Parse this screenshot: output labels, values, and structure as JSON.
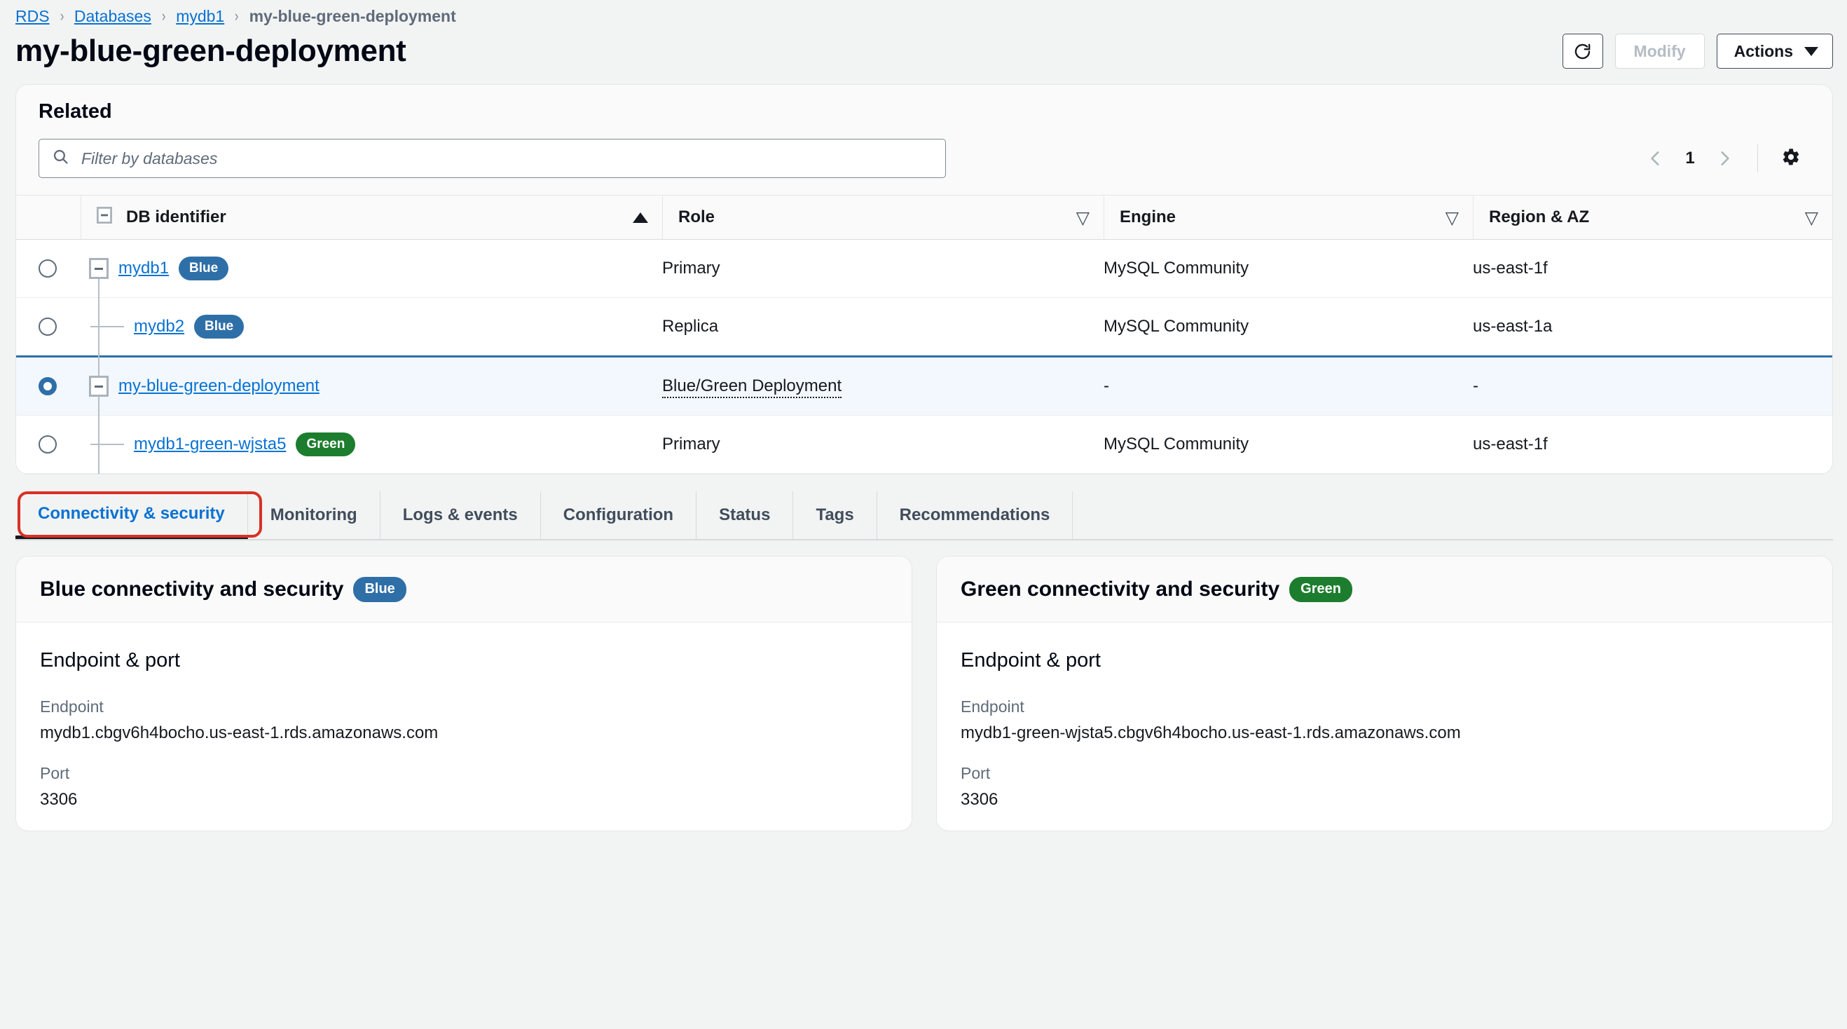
{
  "breadcrumb": {
    "items": [
      {
        "label": "RDS",
        "type": "link"
      },
      {
        "label": "Databases",
        "type": "link"
      },
      {
        "label": "mydb1",
        "type": "link"
      },
      {
        "label": "my-blue-green-deployment",
        "type": "current"
      }
    ],
    "separator": "›"
  },
  "header": {
    "title": "my-blue-green-deployment",
    "refresh_icon": "refresh-icon",
    "modify_label": "Modify",
    "actions_label": "Actions"
  },
  "related": {
    "title": "Related",
    "filter": {
      "placeholder": "Filter by databases",
      "value": "",
      "icon": "search-icon"
    },
    "pagination": {
      "prev_icon": "chevron-left-icon",
      "page": "1",
      "next_icon": "chevron-right-icon"
    },
    "settings_icon": "gear-icon",
    "columns": [
      {
        "label": "DB identifier",
        "sort": "asc"
      },
      {
        "label": "Role",
        "sort": "none"
      },
      {
        "label": "Engine",
        "sort": "none"
      },
      {
        "label": "Region & AZ",
        "sort": "none"
      }
    ],
    "rows": [
      {
        "db_identifier": "mydb1",
        "badge": "Blue",
        "badge_color": "#2f6fa8",
        "role": "Primary",
        "engine": "MySQL Community",
        "region_az": "us-east-1f",
        "selected": false,
        "depth": 0,
        "expandable": true
      },
      {
        "db_identifier": "mydb2",
        "badge": "Blue",
        "badge_color": "#2f6fa8",
        "role": "Replica",
        "engine": "MySQL Community",
        "region_az": "us-east-1a",
        "selected": false,
        "depth": 1,
        "expandable": false
      },
      {
        "db_identifier": "my-blue-green-deployment",
        "badge": null,
        "badge_color": null,
        "role": "Blue/Green Deployment",
        "engine": "-",
        "region_az": "-",
        "selected": true,
        "depth": 0,
        "expandable": true
      },
      {
        "db_identifier": "mydb1-green-wjsta5",
        "badge": "Green",
        "badge_color": "#1d7d2e",
        "role": "Primary",
        "engine": "MySQL Community",
        "region_az": "us-east-1f",
        "selected": false,
        "depth": 1,
        "expandable": false
      }
    ]
  },
  "tabs": {
    "items": [
      {
        "label": "Connectivity & security",
        "active": true
      },
      {
        "label": "Monitoring",
        "active": false
      },
      {
        "label": "Logs & events",
        "active": false
      },
      {
        "label": "Configuration",
        "active": false
      },
      {
        "label": "Status",
        "active": false
      },
      {
        "label": "Tags",
        "active": false
      },
      {
        "label": "Recommendations",
        "active": false
      }
    ],
    "annotation_color": "#d93025"
  },
  "panels": [
    {
      "title": "Blue connectivity and security",
      "badge": "Blue",
      "badge_color": "#2f6fa8",
      "section_title": "Endpoint & port",
      "endpoint_label": "Endpoint",
      "endpoint_value": "mydb1.cbgv6h4bocho.us-east-1.rds.amazonaws.com",
      "port_label": "Port",
      "port_value": "3306"
    },
    {
      "title": "Green connectivity and security",
      "badge": "Green",
      "badge_color": "#1d7d2e",
      "section_title": "Endpoint & port",
      "endpoint_label": "Endpoint",
      "endpoint_value": "mydb1-green-wjsta5.cbgv6h4bocho.us-east-1.rds.amazonaws.com",
      "port_label": "Port",
      "port_value": "3306"
    }
  ]
}
